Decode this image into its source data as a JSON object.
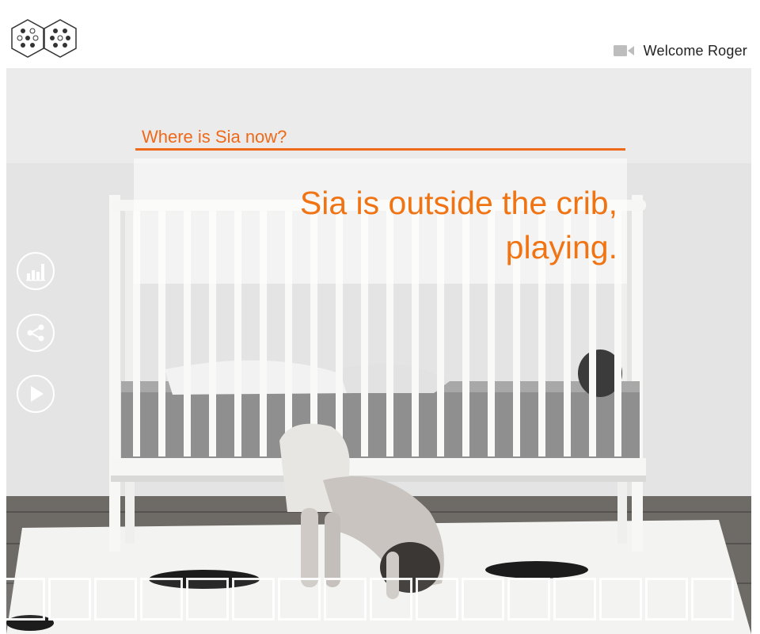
{
  "header": {
    "logo_icon": "dot-hexagon-logo",
    "camera_icon": "video-camera-icon",
    "welcome_text": "Welcome Roger"
  },
  "main": {
    "question": "Where is Sia now?",
    "answer": "Sia is outside the crib, playing."
  },
  "side_actions": [
    {
      "icon": "bar-chart-icon"
    },
    {
      "icon": "share-icon"
    },
    {
      "icon": "play-icon"
    }
  ],
  "thumbnails_count": 16,
  "colors": {
    "accent": "#ee6a1a",
    "answer": "#f07414",
    "text": "#222222"
  }
}
